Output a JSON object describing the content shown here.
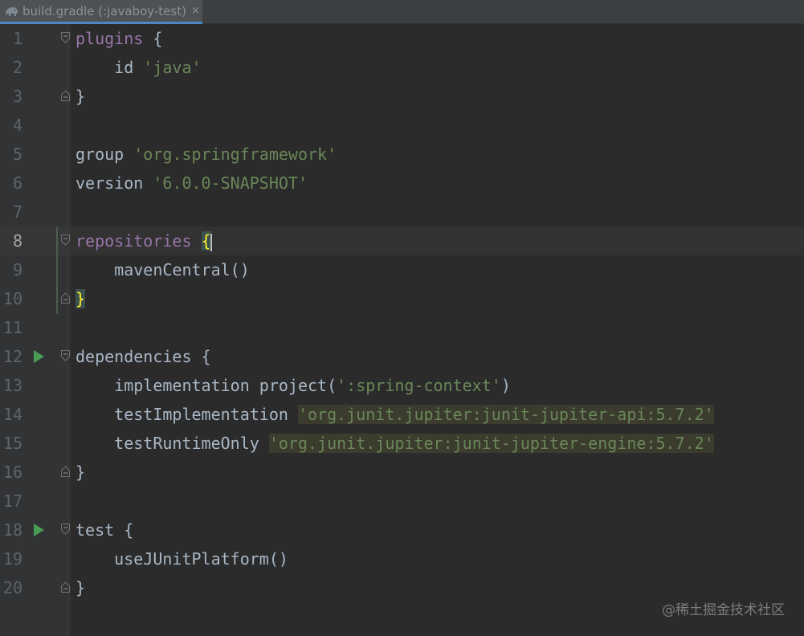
{
  "tab": {
    "title": "build.gradle (:javaboy-test)",
    "close": "×",
    "icon": "gradle-elephant-icon"
  },
  "editor": {
    "current_line": 8,
    "lines": [
      {
        "n": "1",
        "tokens": [
          {
            "t": "plugins",
            "c": "cyan"
          },
          {
            "t": " {",
            "c": "plain"
          }
        ]
      },
      {
        "n": "2",
        "tokens": [
          {
            "t": "    id ",
            "c": "plain"
          },
          {
            "t": "'java'",
            "c": "str"
          }
        ]
      },
      {
        "n": "3",
        "tokens": [
          {
            "t": "}",
            "c": "plain"
          }
        ]
      },
      {
        "n": "4",
        "tokens": []
      },
      {
        "n": "5",
        "tokens": [
          {
            "t": "group ",
            "c": "plain"
          },
          {
            "t": "'org.springframework'",
            "c": "str"
          }
        ]
      },
      {
        "n": "6",
        "tokens": [
          {
            "t": "version ",
            "c": "plain"
          },
          {
            "t": "'6.0.0-SNAPSHOT'",
            "c": "str"
          }
        ]
      },
      {
        "n": "7",
        "tokens": []
      },
      {
        "n": "8",
        "tokens": [
          {
            "t": "repositories",
            "c": "cyan"
          },
          {
            "t": " ",
            "c": "plain"
          },
          {
            "t": "{",
            "c": "brace-hl"
          }
        ]
      },
      {
        "n": "9",
        "tokens": [
          {
            "t": "    mavenCentral()",
            "c": "plain"
          }
        ]
      },
      {
        "n": "10",
        "tokens": [
          {
            "t": "}",
            "c": "brace-hl"
          }
        ]
      },
      {
        "n": "11",
        "tokens": []
      },
      {
        "n": "12",
        "tokens": [
          {
            "t": "dependencies {",
            "c": "plain"
          }
        ]
      },
      {
        "n": "13",
        "tokens": [
          {
            "t": "    implementation project(",
            "c": "plain"
          },
          {
            "t": "':spring-context'",
            "c": "str"
          },
          {
            "t": ")",
            "c": "plain"
          }
        ]
      },
      {
        "n": "14",
        "tokens": [
          {
            "t": "    testImplementation ",
            "c": "plain"
          },
          {
            "t": "'org.junit.jupiter:junit-jupiter-api:5.7.2'",
            "c": "str-hl"
          }
        ]
      },
      {
        "n": "15",
        "tokens": [
          {
            "t": "    testRuntimeOnly ",
            "c": "plain"
          },
          {
            "t": "'org.junit.jupiter:junit-jupiter-engine:5.7.2'",
            "c": "str-hl"
          }
        ]
      },
      {
        "n": "16",
        "tokens": [
          {
            "t": "}",
            "c": "plain"
          }
        ]
      },
      {
        "n": "17",
        "tokens": []
      },
      {
        "n": "18",
        "tokens": [
          {
            "t": "test {",
            "c": "plain"
          }
        ]
      },
      {
        "n": "19",
        "tokens": [
          {
            "t": "    useJUnitPlatform()",
            "c": "plain"
          }
        ]
      },
      {
        "n": "20",
        "tokens": [
          {
            "t": "}",
            "c": "plain"
          }
        ]
      }
    ],
    "run_gutter_lines": [
      12,
      18
    ],
    "fold_open_lines": [
      1,
      8,
      12,
      18
    ],
    "fold_close_lines": [
      3,
      10,
      16,
      20
    ]
  },
  "colors": {
    "background": "#2b2b2b",
    "gutter": "#313335",
    "string": "#6a8759",
    "run_icon": "#499c54",
    "tab_underline": "#4a88c7"
  },
  "watermark": "@稀土掘金技术社区"
}
